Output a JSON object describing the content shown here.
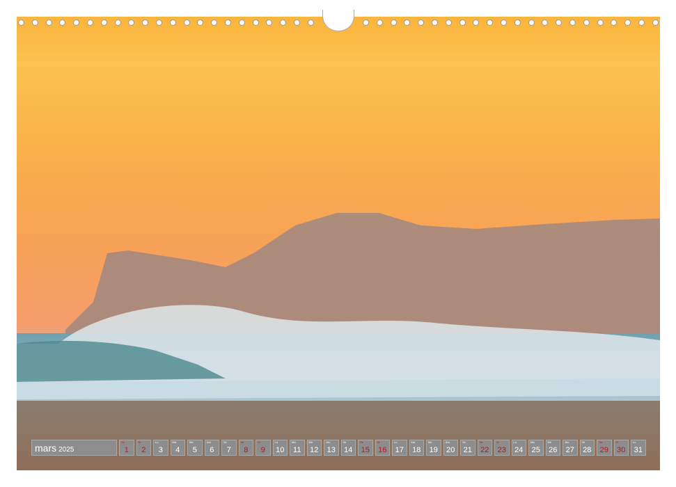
{
  "calendar": {
    "month": "mars",
    "year": "2025",
    "days": [
      {
        "dn": "Sa",
        "n": "1",
        "we": true
      },
      {
        "dn": "Di",
        "n": "2",
        "we": true
      },
      {
        "dn": "Lu",
        "n": "3"
      },
      {
        "dn": "Ma",
        "n": "4"
      },
      {
        "dn": "Me",
        "n": "5"
      },
      {
        "dn": "Jeu",
        "n": "6"
      },
      {
        "dn": "Ve",
        "n": "7"
      },
      {
        "dn": "Sa",
        "n": "8",
        "we": true
      },
      {
        "dn": "Di",
        "n": "9",
        "we": true
      },
      {
        "dn": "Lu",
        "n": "10"
      },
      {
        "dn": "Ma",
        "n": "11"
      },
      {
        "dn": "Me",
        "n": "12"
      },
      {
        "dn": "Jeu",
        "n": "13"
      },
      {
        "dn": "Ve",
        "n": "14"
      },
      {
        "dn": "Sa",
        "n": "15",
        "we": true
      },
      {
        "dn": "Di",
        "n": "16",
        "we": true
      },
      {
        "dn": "Lu",
        "n": "17"
      },
      {
        "dn": "Ma",
        "n": "18"
      },
      {
        "dn": "Me",
        "n": "19"
      },
      {
        "dn": "Jeu",
        "n": "20"
      },
      {
        "dn": "Ve",
        "n": "21"
      },
      {
        "dn": "Sa",
        "n": "22",
        "we": true
      },
      {
        "dn": "Di",
        "n": "23",
        "we": true
      },
      {
        "dn": "Lu",
        "n": "24"
      },
      {
        "dn": "Ma",
        "n": "25"
      },
      {
        "dn": "Me",
        "n": "26"
      },
      {
        "dn": "Jeu",
        "n": "27"
      },
      {
        "dn": "Ve",
        "n": "28"
      },
      {
        "dn": "Sa",
        "n": "29",
        "we": true
      },
      {
        "dn": "Di",
        "n": "30",
        "we": true
      },
      {
        "dn": "Lu",
        "n": "31"
      }
    ],
    "weekend_color": "#c4121e"
  },
  "photo": {
    "subject": "sunset-wave-headland"
  }
}
